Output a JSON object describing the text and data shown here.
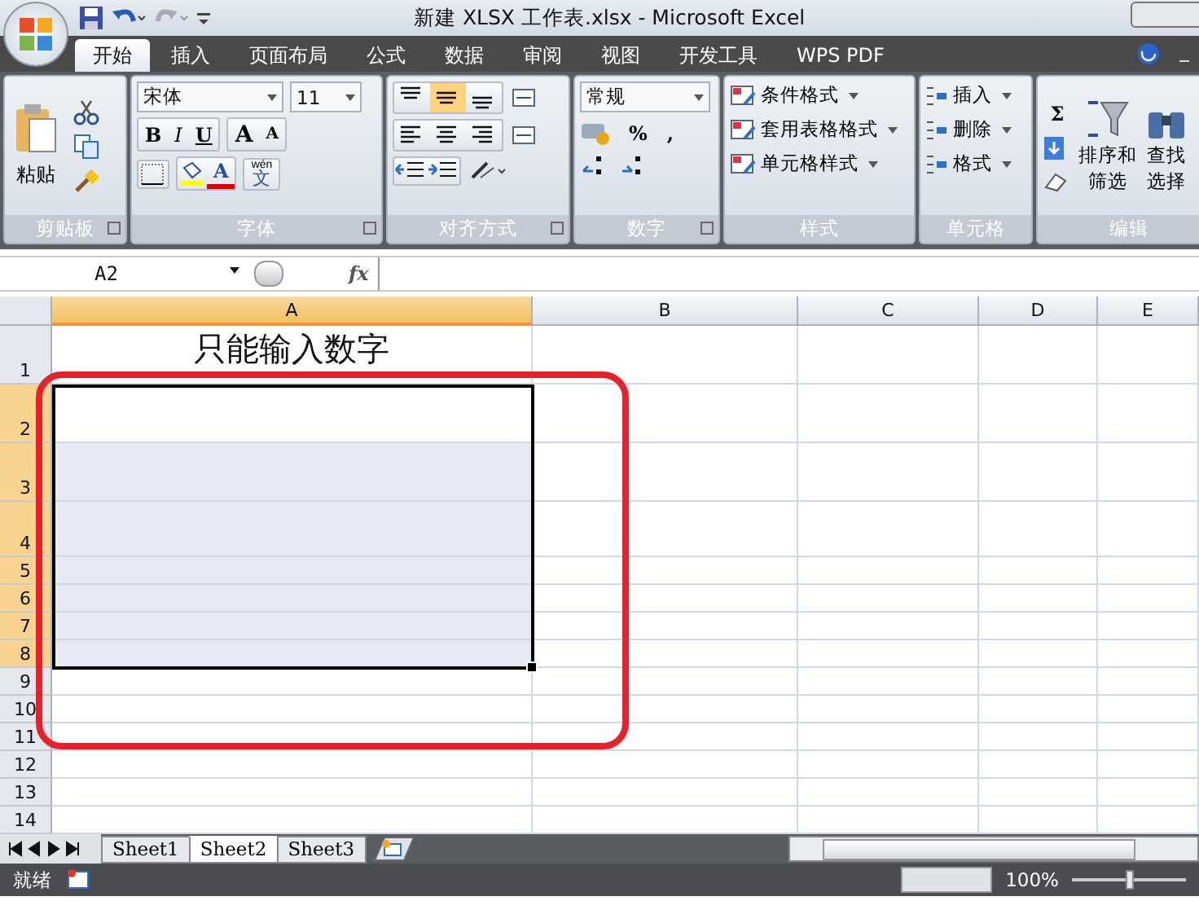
{
  "window": {
    "title": "新建 XLSX 工作表.xlsx - Microsoft Excel"
  },
  "tabs": [
    {
      "label": "开始",
      "selected": true
    },
    {
      "label": "插入",
      "selected": false
    },
    {
      "label": "页面布局",
      "selected": false
    },
    {
      "label": "公式",
      "selected": false
    },
    {
      "label": "数据",
      "selected": false
    },
    {
      "label": "审阅",
      "selected": false
    },
    {
      "label": "视图",
      "selected": false
    },
    {
      "label": "开发工具",
      "selected": false
    },
    {
      "label": "WPS PDF",
      "selected": false
    }
  ],
  "ribbon": {
    "clipboard": {
      "label": "剪贴板",
      "paste": "粘贴"
    },
    "font": {
      "label": "字体",
      "family": "宋体",
      "size": "11",
      "bold": "B",
      "italic": "I",
      "underline": "U",
      "grow": "A",
      "shrink": "A",
      "font_color": "A",
      "phonetic_top": "wén",
      "phonetic_char": "文"
    },
    "alignment": {
      "label": "对齐方式",
      "vertical": [
        {
          "kind": "top",
          "selected": false
        },
        {
          "kind": "middle",
          "selected": true
        },
        {
          "kind": "bottom",
          "selected": false
        }
      ],
      "horizontal": [
        {
          "kind": "left",
          "selected": false
        },
        {
          "kind": "center",
          "selected": false
        },
        {
          "kind": "right",
          "selected": false
        }
      ]
    },
    "number": {
      "label": "数字",
      "format": "常规",
      "percent": "%",
      "comma": ","
    },
    "styles": {
      "label": "样式",
      "items": [
        "条件格式",
        "套用表格格式",
        "单元格样式"
      ]
    },
    "cells": {
      "label": "单元格",
      "items": [
        "插入",
        "删除",
        "格式"
      ]
    },
    "editing": {
      "label": "编辑",
      "sum": "Σ",
      "sort": [
        "排序和",
        "筛选"
      ],
      "find": [
        "查找",
        "选择"
      ]
    }
  },
  "formula_bar": {
    "name_box": "A2",
    "fx": "fx"
  },
  "columns": [
    {
      "label": "A",
      "selected": true
    },
    {
      "label": "B",
      "selected": false
    },
    {
      "label": "C",
      "selected": false
    },
    {
      "label": "D",
      "selected": false
    },
    {
      "label": "E",
      "selected": false
    }
  ],
  "rows": [
    {
      "label": "1",
      "selected": false,
      "cell_a": "只能输入数字"
    },
    {
      "label": "2",
      "selected": true,
      "active": true
    },
    {
      "label": "3",
      "selected": true,
      "active": false
    },
    {
      "label": "4",
      "selected": true,
      "active": false
    },
    {
      "label": "5",
      "selected": true,
      "active": false
    },
    {
      "label": "6",
      "selected": true,
      "active": false
    },
    {
      "label": "7",
      "selected": true,
      "active": false
    },
    {
      "label": "8",
      "selected": true,
      "active": false
    },
    {
      "label": "9",
      "selected": false
    },
    {
      "label": "10",
      "selected": false
    },
    {
      "label": "11",
      "selected": false
    },
    {
      "label": "12",
      "selected": false
    },
    {
      "label": "13",
      "selected": false
    },
    {
      "label": "14",
      "selected": false
    }
  ],
  "sheets": [
    {
      "label": "Sheet1",
      "selected": false
    },
    {
      "label": "Sheet2",
      "selected": true
    },
    {
      "label": "Sheet3",
      "selected": false
    }
  ],
  "status_bar": {
    "status": "就绪",
    "zoom": "100%",
    "zoom_slider": {
      "level": 0.5
    }
  }
}
